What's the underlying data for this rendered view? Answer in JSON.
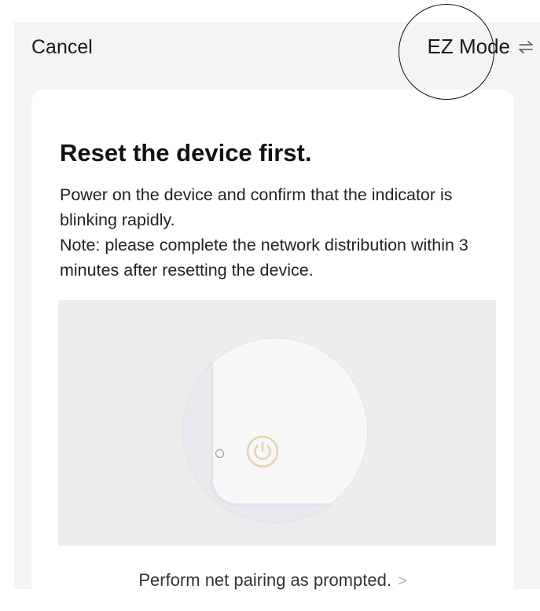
{
  "topbar": {
    "cancel_label": "Cancel",
    "mode_label": "EZ Mode",
    "mode_icon": "swap-arrows-icon"
  },
  "card": {
    "title": "Reset the device first.",
    "description_line1": "Power on the device and confirm that the indicator is blinking rapidly.",
    "description_line2": "Note: please complete the network distribution within 3 minutes after resetting the device.",
    "illustration_icons": [
      "indicator-led-icon",
      "power-button-icon"
    ],
    "prompt_label": "Perform net pairing as prompted.",
    "prompt_chevron": ">"
  },
  "colors": {
    "background": "#f4f4f5",
    "card": "#ffffff",
    "illustration_bg": "#ededee",
    "power_icon": "#e6d2b0",
    "text": "#111111"
  }
}
